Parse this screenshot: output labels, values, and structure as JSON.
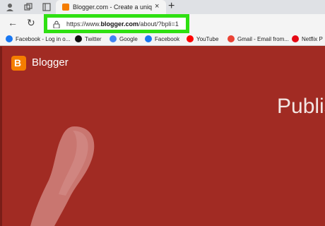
{
  "browser": {
    "tab": {
      "title": "Blogger.com - Create a unique a",
      "close_glyph": "×"
    },
    "new_tab_glyph": "+",
    "nav": {
      "back_glyph": "←",
      "reload_glyph": "↻"
    },
    "omnibox": {
      "url_prefix": "https://www.",
      "url_domain": "blogger.com",
      "url_path": "/about/?bpli=1"
    }
  },
  "bookmarks": [
    {
      "label": "Facebook - Log in o...",
      "icon": "facebook-icon",
      "color": "#1877f2"
    },
    {
      "label": "Twitter",
      "icon": "x-icon",
      "color": "#111111"
    },
    {
      "label": "Google",
      "icon": "google-icon",
      "color": "#4285f4"
    },
    {
      "label": "Facebook",
      "icon": "facebook-icon",
      "color": "#1877f2"
    },
    {
      "label": "YouTube",
      "icon": "youtube-icon",
      "color": "#ff0000"
    },
    {
      "label": "Gmail - Email from...",
      "icon": "gmail-icon",
      "color": "#ea4335"
    },
    {
      "label": "Netflix P",
      "icon": "netflix-icon",
      "color": "#e50914"
    }
  ],
  "page": {
    "logo_letter": "B",
    "logo_text": "Blogger",
    "hero_text": "Publis",
    "colors": {
      "background": "#a12b23",
      "brand": "#f57d00",
      "highlight": "#2fe012"
    }
  }
}
